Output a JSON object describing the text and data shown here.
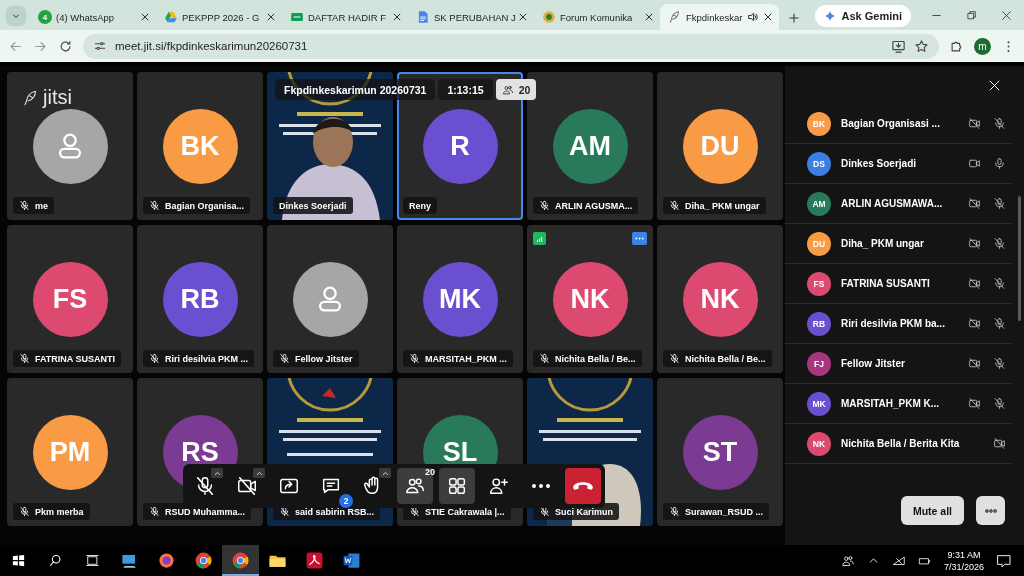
{
  "browser": {
    "tabs": [
      {
        "title": "(4) WhatsApp",
        "kind": "whatsapp",
        "badge": "4",
        "selected": false,
        "audio": false
      },
      {
        "title": "PEKPPP 2026 - G",
        "kind": "drive",
        "selected": false,
        "audio": false
      },
      {
        "title": "DAFTAR HADIR F",
        "kind": "sheet",
        "selected": false,
        "audio": false
      },
      {
        "title": "SK PERUBAHAN J",
        "kind": "doc",
        "selected": false,
        "audio": false
      },
      {
        "title": "Forum Komunika",
        "kind": "emblem",
        "selected": false,
        "audio": false
      },
      {
        "title": "Fkpdinkeskar",
        "kind": "jitsi",
        "selected": true,
        "audio": true
      }
    ],
    "gemini_button": "Ask Gemini",
    "url": "meet.jit.si/fkpdinkeskarimun20260731",
    "profile": "m"
  },
  "meeting": {
    "logo": "jitsi",
    "title": "Fkpdinkeskarimun 20260731",
    "duration": "1:13:15",
    "participant_count": "20"
  },
  "tiles": [
    {
      "kind": "placeholder",
      "name": "me",
      "color": "#a6a6a6",
      "muted": true,
      "speaking": false,
      "hovered": false
    },
    {
      "kind": "avatar",
      "initials": "BK",
      "color": "#f99a45",
      "name": "Bagian Organisa...",
      "muted": true,
      "speaking": false,
      "hovered": false
    },
    {
      "kind": "video",
      "name": "Dinkes Soerjadi",
      "muted": false,
      "speaking": false,
      "hovered": false
    },
    {
      "kind": "avatar",
      "initials": "R",
      "color": "#6a4fd0",
      "name": "Reny",
      "muted": false,
      "speaking": true,
      "hovered": false
    },
    {
      "kind": "avatar",
      "initials": "AM",
      "color": "#287a5b",
      "name": "ARLIN AGUSMA...",
      "muted": true,
      "speaking": false,
      "hovered": false
    },
    {
      "kind": "avatar",
      "initials": "DU",
      "color": "#f99a45",
      "name": "Diha_ PKM ungar",
      "muted": true,
      "speaking": false,
      "hovered": false
    },
    {
      "kind": "avatar",
      "initials": "FS",
      "color": "#dd4a6f",
      "name": "FATRINA SUSANTI",
      "muted": true,
      "speaking": false,
      "hovered": false
    },
    {
      "kind": "avatar",
      "initials": "RB",
      "color": "#6a4fd0",
      "name": "Riri desilvia PKM ...",
      "muted": true,
      "speaking": false,
      "hovered": false
    },
    {
      "kind": "placeholder",
      "name": "Fellow Jitster",
      "color": "#a6a6a6",
      "muted": true,
      "speaking": false,
      "hovered": false
    },
    {
      "kind": "avatar",
      "initials": "MK",
      "color": "#6a4fd0",
      "name": "MARSITAH_PKM ...",
      "muted": true,
      "speaking": false,
      "hovered": false
    },
    {
      "kind": "avatar",
      "initials": "NK",
      "color": "#dd4a6f",
      "name": "Nichita Bella / Be...",
      "muted": true,
      "speaking": false,
      "hovered": true
    },
    {
      "kind": "avatar",
      "initials": "NK",
      "color": "#dd4a6f",
      "name": "Nichita Bella / Be...",
      "muted": true,
      "speaking": false,
      "hovered": false
    },
    {
      "kind": "avatar",
      "initials": "PM",
      "color": "#f99a45",
      "name": "Pkm merba",
      "muted": true,
      "speaking": false,
      "hovered": false
    },
    {
      "kind": "avatar",
      "initials": "RS",
      "color": "#7c3b93",
      "name": "RSUD Muhamma...",
      "muted": true,
      "speaking": false,
      "hovered": false
    },
    {
      "kind": "video",
      "name": "said sabirin RSB...",
      "muted": true,
      "speaking": false,
      "hovered": false
    },
    {
      "kind": "avatar",
      "initials": "SL",
      "color": "#287a5b",
      "name": "STIE Cakrawala |...",
      "muted": true,
      "speaking": false,
      "hovered": false
    },
    {
      "kind": "video",
      "name": "Suci Karimun",
      "muted": true,
      "speaking": false,
      "hovered": false
    },
    {
      "kind": "avatar",
      "initials": "ST",
      "color": "#7c3b93",
      "name": "Surawan_RSUD ...",
      "muted": true,
      "speaking": false,
      "hovered": false
    }
  ],
  "toolbar": [
    {
      "kind": "mic",
      "off": true,
      "caret": true,
      "active": false
    },
    {
      "kind": "camera",
      "off": true,
      "caret": true,
      "active": false
    },
    {
      "kind": "share",
      "off": false,
      "caret": false,
      "active": false
    },
    {
      "kind": "chat",
      "off": false,
      "caret": false,
      "active": false,
      "badge": "2"
    },
    {
      "kind": "hand",
      "off": false,
      "caret": true,
      "active": false
    },
    {
      "kind": "participants",
      "off": false,
      "caret": false,
      "active": true,
      "badge": "20"
    },
    {
      "kind": "tileview",
      "off": false,
      "caret": false,
      "active": true
    },
    {
      "kind": "invite",
      "off": false,
      "caret": false,
      "active": false
    },
    {
      "kind": "more",
      "off": false,
      "caret": false,
      "active": false
    },
    {
      "kind": "hangup",
      "off": false,
      "caret": false,
      "active": false
    }
  ],
  "participants_pane": {
    "rows": [
      {
        "initials": "BK",
        "color": "#f99a45",
        "name": "Bagian Organisasi ...",
        "video": false,
        "mic_shown": true,
        "mic_muted": true
      },
      {
        "initials": "DS",
        "color": "#3b7fe0",
        "name": "Dinkes Soerjadi",
        "video": true,
        "mic_shown": true,
        "mic_muted": false
      },
      {
        "initials": "AM",
        "color": "#287a5b",
        "name": "ARLIN AGUSMAWA...",
        "video": false,
        "mic_shown": true,
        "mic_muted": true
      },
      {
        "initials": "DU",
        "color": "#f99a45",
        "name": "Diha_ PKM ungar",
        "video": false,
        "mic_shown": true,
        "mic_muted": true
      },
      {
        "initials": "FS",
        "color": "#dd4a6f",
        "name": "FATRINA SUSANTI",
        "video": false,
        "mic_shown": true,
        "mic_muted": true
      },
      {
        "initials": "RB",
        "color": "#6a4fd0",
        "name": "Riri desilvia PKM ba...",
        "video": false,
        "mic_shown": true,
        "mic_muted": true
      },
      {
        "initials": "FJ",
        "color": "#a8367f",
        "name": "Fellow Jitster",
        "video": false,
        "mic_shown": true,
        "mic_muted": true
      },
      {
        "initials": "MK",
        "color": "#6a4fd0",
        "name": "MARSITAH_PKM K...",
        "video": false,
        "mic_shown": true,
        "mic_muted": true
      },
      {
        "initials": "NK",
        "color": "#dd4a6f",
        "name": "Nichita Bella / Berita Kita",
        "video": false,
        "mic_shown": false
      }
    ],
    "mute_all": "Mute all"
  },
  "taskbar": {
    "apps": [
      {
        "kind": "pc",
        "selected": false
      },
      {
        "kind": "firefox",
        "selected": false
      },
      {
        "kind": "chrome",
        "selected": false
      },
      {
        "kind": "chrome",
        "selected": true
      },
      {
        "kind": "folder",
        "selected": false
      },
      {
        "kind": "acrobat",
        "selected": false
      },
      {
        "kind": "word",
        "selected": false
      }
    ],
    "time": "9:31 AM",
    "date": "7/31/2026"
  }
}
